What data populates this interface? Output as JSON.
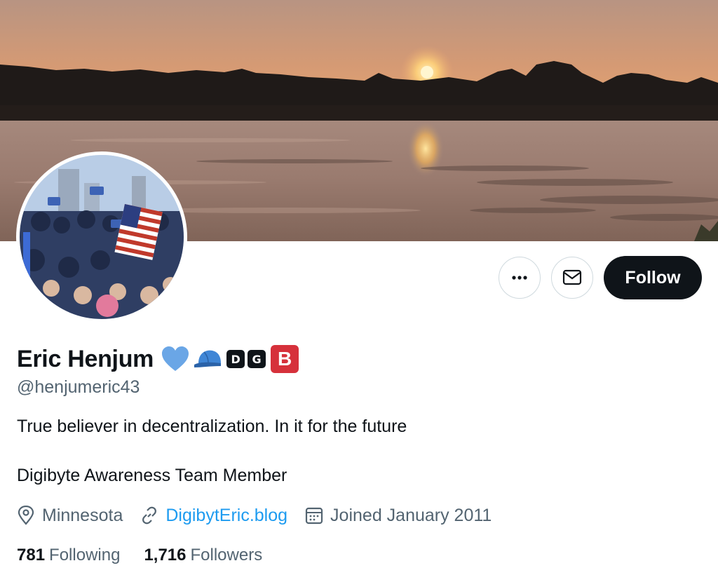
{
  "profile": {
    "display_name": "Eric Henjum",
    "handle": "@henjumeric43",
    "name_badges": [
      "D",
      "G"
    ],
    "name_badge_big": "B",
    "bio_line_1": "True believer in decentralization. In it for the future",
    "bio_line_2": "Digibyte Awareness Team Member",
    "location": "Minnesota",
    "website": "DigibytEric.blog",
    "joined": "Joined January 2011",
    "following_count": "781",
    "following_label": "Following",
    "followers_count": "1,716",
    "followers_label": "Followers"
  },
  "actions": {
    "more_icon": "more-horizontal-icon",
    "message_icon": "envelope-icon",
    "follow_label": "Follow"
  },
  "icons": {
    "location": "location-pin-icon",
    "link": "link-icon",
    "calendar": "calendar-icon",
    "heart": "blue-heart-icon",
    "cap": "blue-cap-icon"
  },
  "colors": {
    "text_primary": "#0f1419",
    "text_secondary": "#536471",
    "link": "#1d9bf0",
    "follow_bg": "#0f1419",
    "heart": "#6aa6e6",
    "badge_b": "#d6313b"
  }
}
